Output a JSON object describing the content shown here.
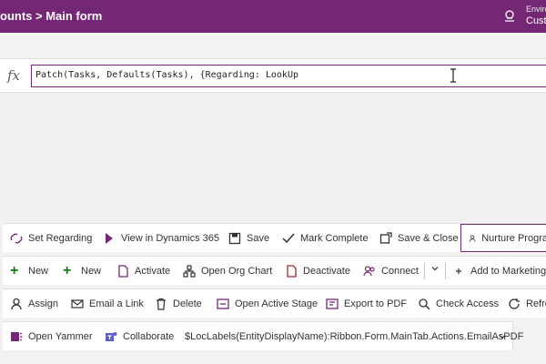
{
  "topbar": {
    "breadcrumb": "ounts > Main form",
    "env_label": "Enviro",
    "env_name": "Custo"
  },
  "formula": {
    "fx": "fx",
    "text": "Patch(Tasks, Defaults(Tasks), {Regarding: LookUp"
  },
  "row1": {
    "set_regarding": "Set Regarding",
    "view_in_dynamics": "View in Dynamics 365",
    "save": "Save",
    "mark_complete": "Mark Complete",
    "save_close": "Save & Close",
    "nurture": "Nurture Progra"
  },
  "row2": {
    "new1": "New",
    "new2": "New",
    "activate": "Activate",
    "open_org_chart": "Open Org Chart",
    "deactivate": "Deactivate",
    "connect": "Connect",
    "add_to_marketing": "Add to Marketing L"
  },
  "row3": {
    "assign": "Assign",
    "email_link": "Email a Link",
    "delete": "Delete",
    "open_active_stage": "Open Active Stage",
    "export_pdf": "Export to PDF",
    "check_access": "Check Access",
    "refresh": "Refre"
  },
  "row4": {
    "open_yammer": "Open Yammer",
    "collaborate": "Collaborate",
    "loc_labels": "$LocLabels(EntityDisplayName):Ribbon.Form.MainTab.Actions.EmailAsPDF"
  },
  "colors": {
    "brand": "#742774",
    "icon_purple": "#742774",
    "icon_green": "#107c10"
  }
}
